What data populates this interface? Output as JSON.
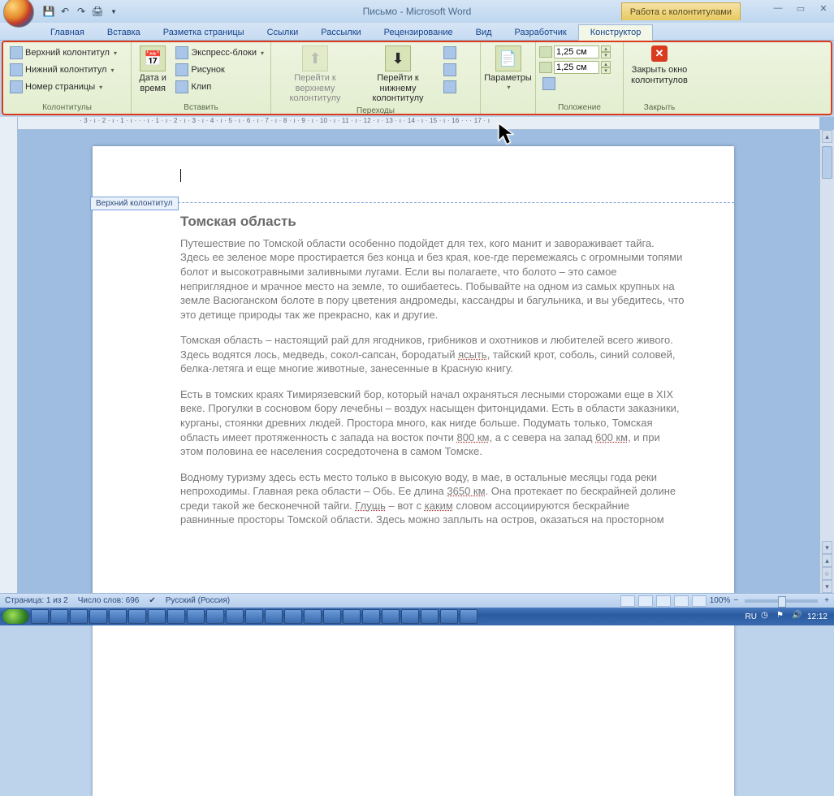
{
  "title": "Письмо - Microsoft Word",
  "contextual_tab": "Работа с колонтитулами",
  "tabs": [
    "Главная",
    "Вставка",
    "Разметка страницы",
    "Ссылки",
    "Рассылки",
    "Рецензирование",
    "Вид",
    "Разработчик",
    "Конструктор"
  ],
  "active_tab": "Конструктор",
  "ribbon": {
    "headers": {
      "group_label": "Колонтитулы",
      "top": "Верхний колонтитул",
      "bottom": "Нижний колонтитул",
      "pagenum": "Номер страницы"
    },
    "insert": {
      "group_label": "Вставить",
      "datetime_1": "Дата и",
      "datetime_2": "время",
      "blocks": "Экспресс-блоки",
      "picture": "Рисунок",
      "clip": "Клип"
    },
    "nav": {
      "group_label": "Переходы",
      "prev_1": "Перейти к верхнему",
      "prev_2": "колонтитулу",
      "next_1": "Перейти к нижнему",
      "next_2": "колонтитулу"
    },
    "options": {
      "label_1": "Параметры",
      "label_2": ""
    },
    "position": {
      "group_label": "Положение",
      "val1": "1,25 см",
      "val2": "1,25 см"
    },
    "close": {
      "group_label": "Закрыть",
      "label_1": "Закрыть окно",
      "label_2": "колонтитулов"
    }
  },
  "ruler_text": "· 3 · ı · 2 · ı · 1 · ı · · · ı · 1 · ı · 2 · ı · 3 · ı · 4 · ı · 5 · ı · 6 · ı · 7 · ı · 8 · ı · 9 · ı · 10 · ı · 11 · ı · 12 · ı · 13 · ı · 14 · ı · 15 · ı · 16 · · · 17 · ı",
  "header_tab_label": "Верхний колонтитул",
  "document": {
    "heading": "Томская область",
    "p1": "Путешествие по Томской области особенно подойдет для тех, кого манит и завораживает тайга. Здесь ее зеленое море простирается без конца и без края, кое-где перемежаясь с огромными топями болот и высокотравными заливными лугами. Если вы полагаете, что болото – это самое неприглядное и мрачное место на земле, то ошибаетесь. Побывайте на одном из самых крупных на земле Васюганском болоте в пору цветения андромеды, кассандры и багульника, и вы убедитесь, что это детище природы так же прекрасно, как и другие.",
    "p2_a": "Томская область – настоящий рай для ягодников, грибников и охотников и любителей всего живого. Здесь водятся лось, медведь, сокол-сапсан, бородатый ",
    "p2_u": "ясыть",
    "p2_b": ", тайский крот, соболь, синий соловей, белка-летяга и еще многие животные, занесенные в Красную книгу.",
    "p3_a": "Есть в томских краях Тимирязевский бор, который начал охраняться лесными сторожами еще в XIX веке. Прогулки в сосновом бору лечебны – воздух насыщен фитонцидами. Есть в области заказники, курганы, стоянки древних людей. Простора много, как нигде больше. Подумать только, Томская область имеет протяженность с запада на восток почти ",
    "p3_u1": "800 км",
    "p3_b": ", а с севера на запад ",
    "p3_u2": "600 км",
    "p3_c": ", и при этом половина ее населения сосредоточена в самом Томске.",
    "p4_a": "Водному туризму здесь есть место только в высокую воду, в мае, в остальные месяцы года реки непроходимы. Главная река области – Обь. Ее длина ",
    "p4_u1": "3650 км",
    "p4_b": ". Она протекает по бескрайней долине среди такой же бесконечной тайги. ",
    "p4_u2": "Глушь",
    "p4_c": " – вот с ",
    "p4_u3": "каким",
    "p4_d": " словом ассоциируются бескрайние равнинные просторы Томской области. Здесь можно заплыть на остров, оказаться на просторном"
  },
  "status": {
    "page": "Страница: 1 из 2",
    "words": "Число слов: 696",
    "lang": "Русский (Россия)",
    "zoom": "100%"
  },
  "tray": {
    "lang": "RU",
    "time": "12:12"
  }
}
